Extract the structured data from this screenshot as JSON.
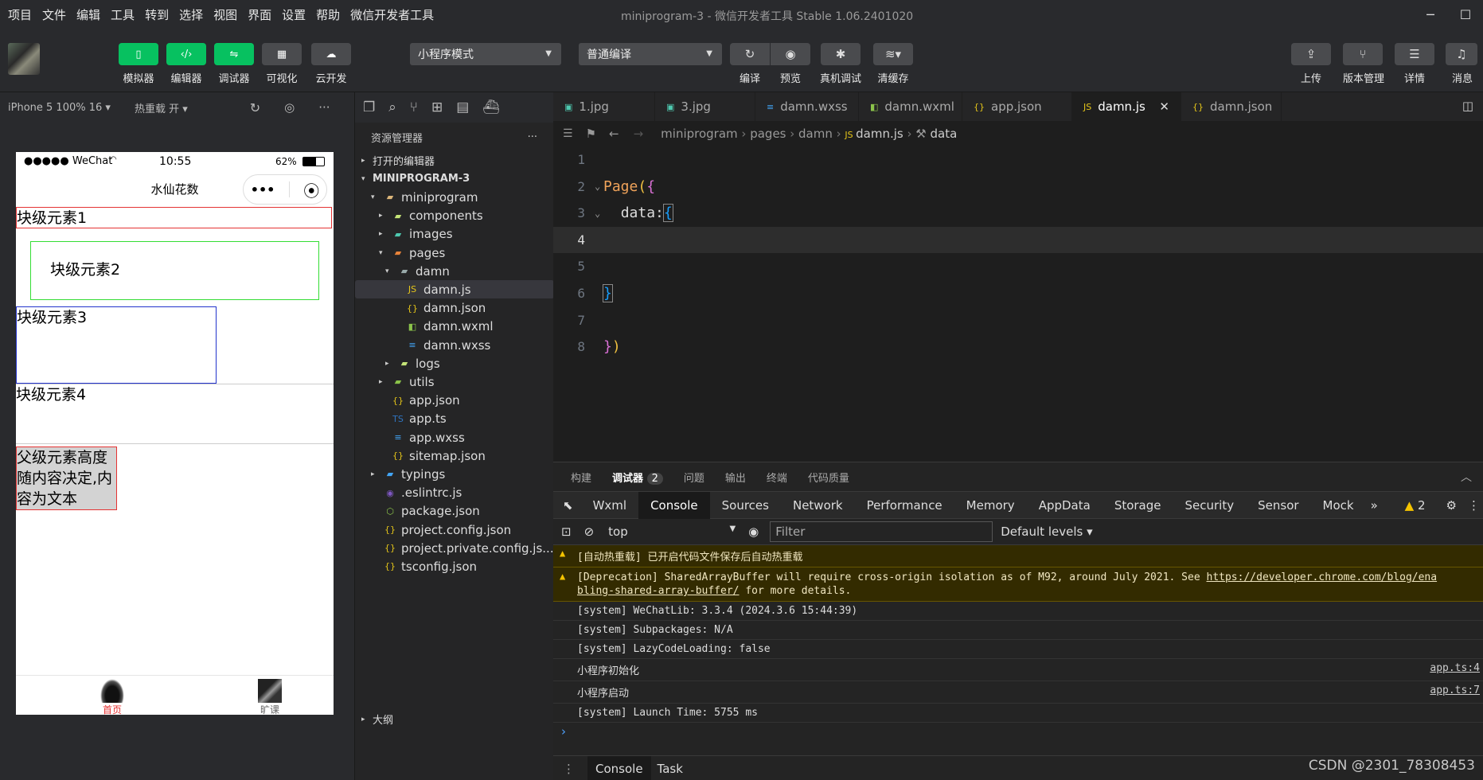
{
  "menubar": {
    "items": [
      "项目",
      "文件",
      "编辑",
      "工具",
      "转到",
      "选择",
      "视图",
      "界面",
      "设置",
      "帮助",
      "微信开发者工具"
    ],
    "title": "miniprogram-3 - 微信开发者工具 Stable 1.06.2401020"
  },
  "toolbar": {
    "simulator": "模拟器",
    "editor": "编辑器",
    "debugger": "调试器",
    "visual": "可视化",
    "cloud": "云开发",
    "mode_select": "小程序模式",
    "compile_select": "普通编译",
    "compile": "编译",
    "preview": "预览",
    "real_debug": "真机调试",
    "clear_cache": "清缓存",
    "upload": "上传",
    "version": "版本管理",
    "details": "详情",
    "messages": "消息"
  },
  "simulator": {
    "device": "iPhone 5 100% 16",
    "hot_reload": "热重载 开"
  },
  "phone": {
    "carrier": "●●●●● WeChat",
    "time": "10:55",
    "battery": "62%",
    "nav_title": "水仙花数",
    "block1": "块级元素1",
    "block2": "块级元素2",
    "block3": "块级元素3",
    "block4": "块级元素4",
    "block5": "父级元素高度随内容决定,内容为文本",
    "tab_home": "首页",
    "tab_course": "旷课"
  },
  "explorer": {
    "title": "资源管理器",
    "open_editors": "打开的编辑器",
    "project": "MINIPROGRAM-3",
    "items": [
      {
        "label": "miniprogram",
        "icon": "folder-icon"
      },
      {
        "label": "components",
        "icon": "folder-icon"
      },
      {
        "label": "images",
        "icon": "folder-icon"
      },
      {
        "label": "pages",
        "icon": "folder-icon"
      },
      {
        "label": "damn",
        "icon": "folder-icon"
      },
      {
        "label": "damn.js",
        "icon": "js-file-icon"
      },
      {
        "label": "damn.json",
        "icon": "json-file-icon"
      },
      {
        "label": "damn.wxml",
        "icon": "wxml-file-icon"
      },
      {
        "label": "damn.wxss",
        "icon": "wxss-file-icon"
      },
      {
        "label": "logs",
        "icon": "folder-icon"
      },
      {
        "label": "utils",
        "icon": "folder-icon"
      },
      {
        "label": "app.json",
        "icon": "json-file-icon"
      },
      {
        "label": "app.ts",
        "icon": "ts-file-icon"
      },
      {
        "label": "app.wxss",
        "icon": "wxss-file-icon"
      },
      {
        "label": "sitemap.json",
        "icon": "json-file-icon"
      },
      {
        "label": "typings",
        "icon": "folder-icon"
      },
      {
        "label": ".eslintrc.js",
        "icon": "eslint-file-icon"
      },
      {
        "label": "package.json",
        "icon": "package-file-icon"
      },
      {
        "label": "project.config.json",
        "icon": "json-file-icon"
      },
      {
        "label": "project.private.config.js...",
        "icon": "json-file-icon"
      },
      {
        "label": "tsconfig.json",
        "icon": "json-file-icon"
      }
    ],
    "outline": "大纲"
  },
  "editor": {
    "tabs": [
      "1.jpg",
      "3.jpg",
      "damn.wxss",
      "damn.wxml",
      "app.json",
      "damn.js",
      "damn.json"
    ],
    "breadcrumb": [
      "miniprogram",
      "pages",
      "damn",
      "damn.js",
      "data"
    ],
    "lines": [
      "1",
      "2",
      "3",
      "4",
      "5",
      "6",
      "7",
      "8"
    ],
    "code_page": "Page",
    "code_data": "data"
  },
  "devtools": {
    "top_tabs": [
      "构建",
      "调试器",
      "问题",
      "输出",
      "终端",
      "代码质量"
    ],
    "debugger_badge": "2",
    "tabs": [
      "Wxml",
      "Console",
      "Sources",
      "Network",
      "Performance",
      "Memory",
      "AppData",
      "Storage",
      "Security",
      "Sensor",
      "Mock"
    ],
    "warn_count": "2",
    "context": "top",
    "filter_placeholder": "Filter",
    "levels": "Default levels",
    "msg1": "[自动热重载] 已开启代码文件保存后自动热重载",
    "msg2a": "[Deprecation] SharedArrayBuffer will require cross-origin isolation as of M92, around July 2021. See ",
    "msg2link": "https://developer.chrome.com/blog/ena",
    "msg2b": "bling-shared-array-buffer/",
    "msg2c": " for more details.",
    "msg3": "[system] WeChatLib: 3.3.4 (2024.3.6 15:44:39)",
    "msg4": "[system] Subpackages: N/A",
    "msg5": "[system] LazyCodeLoading: false",
    "msg6": "小程序初始化",
    "msg6src": "app.ts:4",
    "msg7": "小程序启动",
    "msg7src": "app.ts:7",
    "msg8": "[system] Launch Time: 5755 ms",
    "prompt": "›",
    "bottom_console": "Console",
    "bottom_task": "Task"
  },
  "watermark": "CSDN @2301_78308453"
}
